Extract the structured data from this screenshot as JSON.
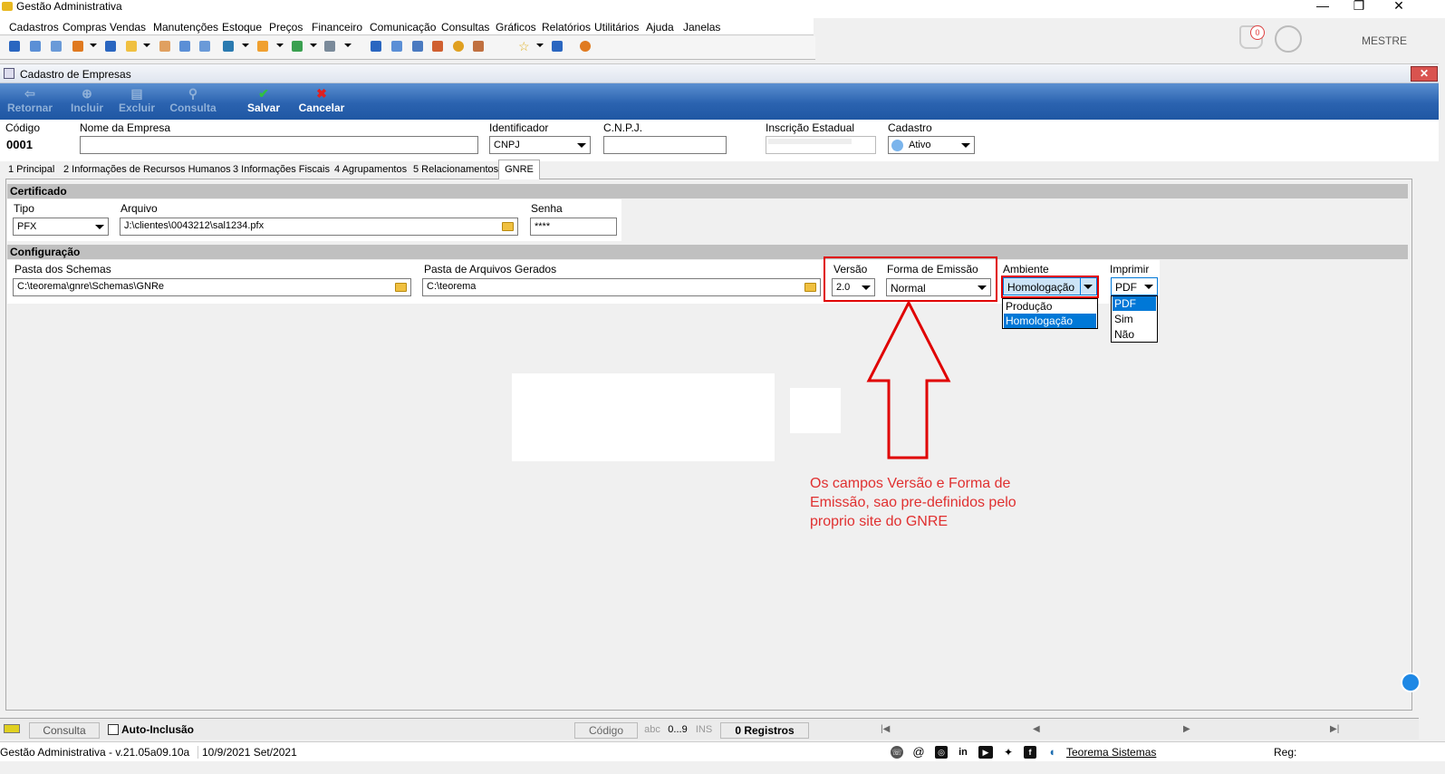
{
  "app": {
    "title": "Gestão Administrativa"
  },
  "menu": [
    "Cadastros",
    "Compras",
    "Vendas",
    "Manutenções",
    "Estoque",
    "Preços",
    "Financeiro",
    "Comunicação",
    "Consultas",
    "Gráficos",
    "Relatórios",
    "Utilitários",
    "Ajuda",
    "Janelas"
  ],
  "notifications": {
    "count": "0"
  },
  "user": {
    "name": "MESTRE"
  },
  "window": {
    "title": "Cadastro de Empresas",
    "close": "✕"
  },
  "actions": {
    "retornar": "Retornar",
    "incluir": "Incluir",
    "excluir": "Excluir",
    "consulta": "Consulta",
    "salvar": "Salvar",
    "cancelar": "Cancelar"
  },
  "header_form": {
    "codigo_label": "Código",
    "codigo_value": "0001",
    "nome_label": "Nome da Empresa",
    "nome_value": "",
    "identificador_label": "Identificador",
    "identificador_value": "CNPJ",
    "cnpj_label": "C.N.P.J.",
    "cnpj_value": "",
    "ie_label": "Inscrição Estadual",
    "cadastro_label": "Cadastro",
    "cadastro_value": "Ativo"
  },
  "tabs": [
    "1 Principal",
    "2 Informações de Recursos Humanos",
    "3 Informações Fiscais",
    "4 Agrupamentos",
    "5 Relacionamentos",
    "GNRE"
  ],
  "certificado": {
    "section": "Certificado",
    "tipo_label": "Tipo",
    "tipo_value": "PFX",
    "arquivo_label": "Arquivo",
    "arquivo_value": "J:\\clientes\\0043212\\sal1234.pfx",
    "senha_label": "Senha",
    "senha_value": "****"
  },
  "configuracao": {
    "section": "Configuração",
    "schemas_label": "Pasta dos Schemas",
    "schemas_value": "C:\\teorema\\gnre\\Schemas\\GNRe",
    "gerados_label": "Pasta de Arquivos Gerados",
    "gerados_value": "C:\\teorema",
    "versao_label": "Versão",
    "versao_value": "2.0",
    "forma_label": "Forma de Emissão",
    "forma_value": "Normal",
    "ambiente_label": "Ambiente",
    "ambiente_value": "Homologação",
    "ambiente_options": [
      "Produção",
      "Homologação"
    ],
    "imprimir_label": "Imprimir",
    "imprimir_value": "PDF",
    "imprimir_options": [
      "PDF",
      "Sim",
      "Não"
    ]
  },
  "annotation": {
    "note": "Os campos Versão e Forma de Emissão, sao pre-definidos pelo proprio site do GNRE"
  },
  "statusbar": {
    "consulta": "Consulta",
    "auto_inclusao": "Auto-Inclusão",
    "codigo": "Código",
    "abc": "abc",
    "num": "0...9",
    "ins": "INS",
    "registros": "0 Registros",
    "first": "|◀",
    "prev": "◀",
    "next": "▶",
    "last": "▶|"
  },
  "bottombar": {
    "version": "Gestão Administrativa - v.21.05a09.10a",
    "date": "10/9/2021 Set/2021",
    "company": "Teorema Sistemas",
    "reg": "Reg:"
  },
  "colors": {
    "action_bar": "#2b63b0",
    "highlight": "#e00000",
    "selection": "#0078d7"
  }
}
